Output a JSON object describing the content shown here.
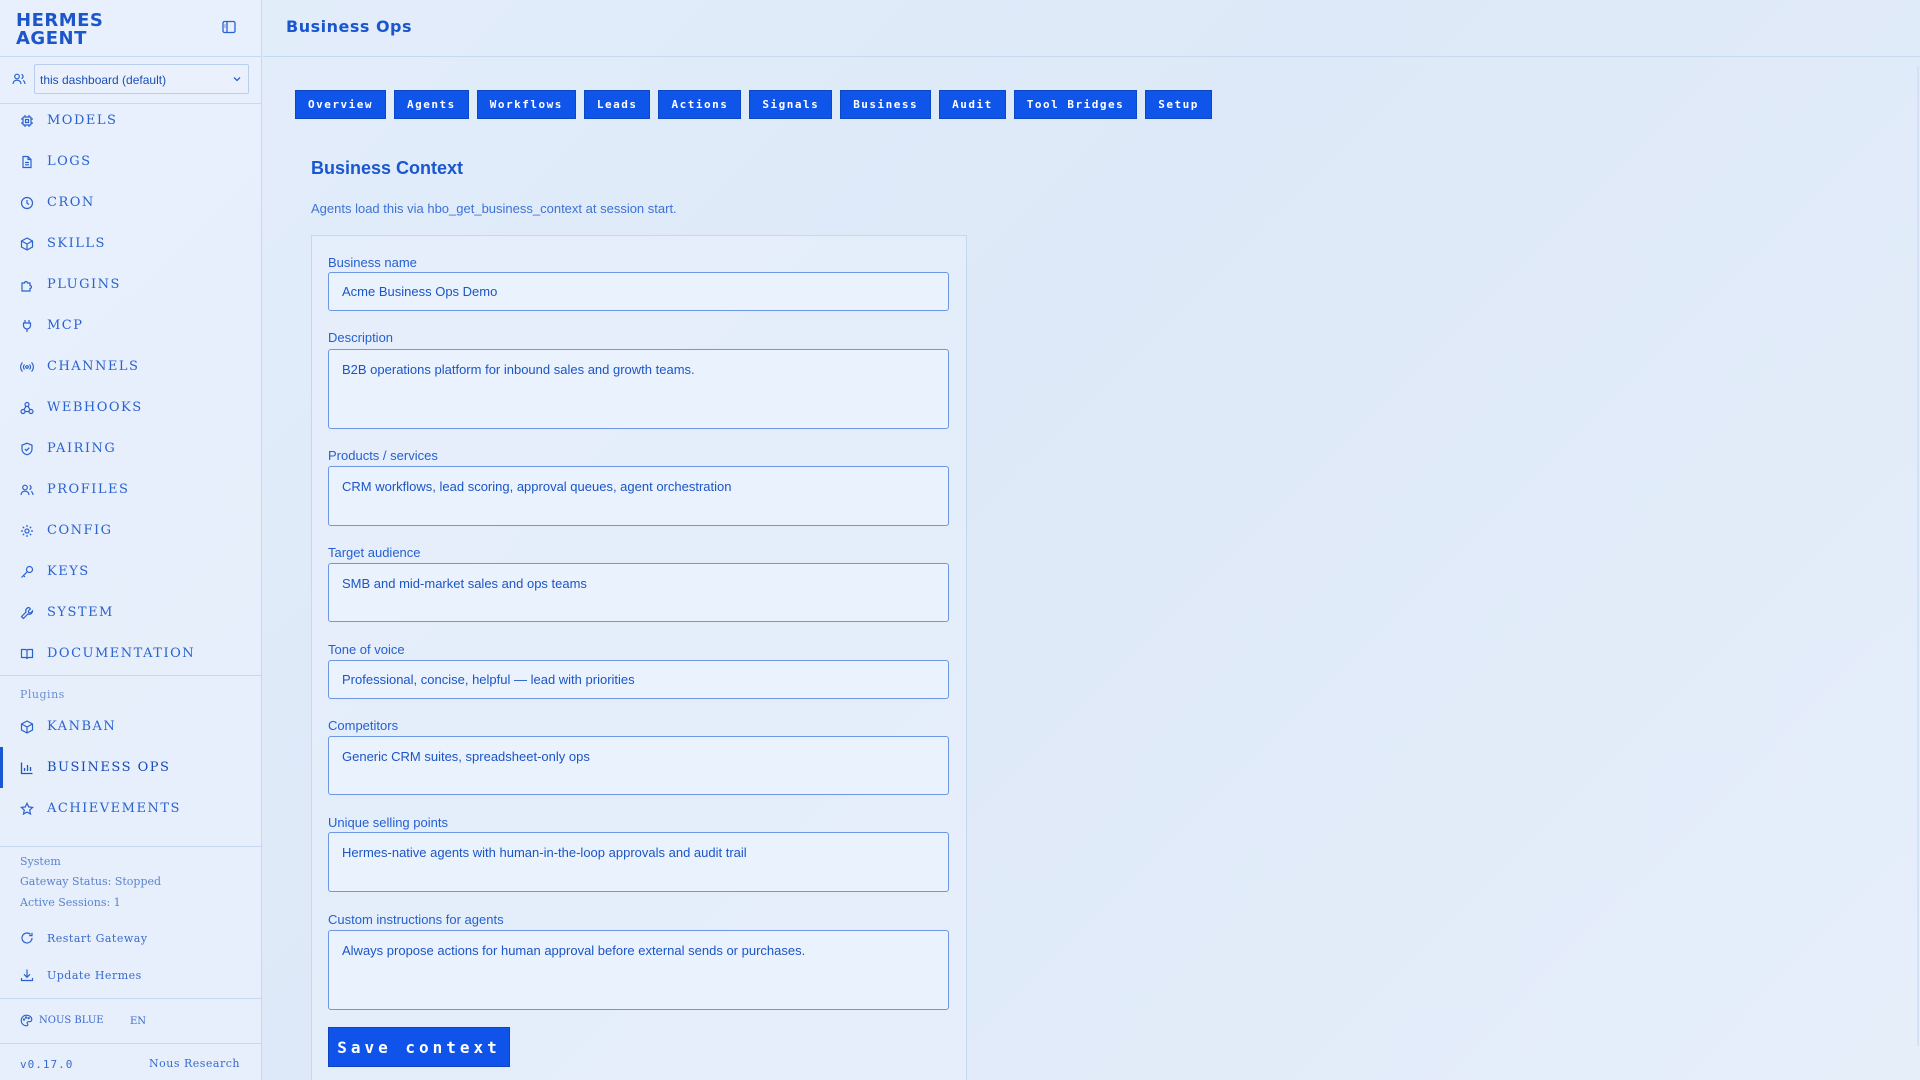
{
  "brand": {
    "line1": "HERMES",
    "line2": "AGENT"
  },
  "profile_select": {
    "value": "this dashboard (default)"
  },
  "nav": {
    "items": [
      {
        "label": "MODELS",
        "icon": "cube-icon"
      },
      {
        "label": "LOGS",
        "icon": "file-icon"
      },
      {
        "label": "CRON",
        "icon": "clock-icon"
      },
      {
        "label": "SKILLS",
        "icon": "package-icon"
      },
      {
        "label": "PLUGINS",
        "icon": "puzzle-icon"
      },
      {
        "label": "MCP",
        "icon": "plug-icon"
      },
      {
        "label": "CHANNELS",
        "icon": "radio-icon"
      },
      {
        "label": "WEBHOOKS",
        "icon": "webhook-icon"
      },
      {
        "label": "PAIRING",
        "icon": "shield-icon"
      },
      {
        "label": "PROFILES",
        "icon": "users-icon"
      },
      {
        "label": "CONFIG",
        "icon": "gear-icon"
      },
      {
        "label": "KEYS",
        "icon": "key-icon"
      },
      {
        "label": "SYSTEM",
        "icon": "wrench-icon"
      },
      {
        "label": "DOCUMENTATION",
        "icon": "book-icon"
      }
    ],
    "plugins_label": "Plugins",
    "plugins": [
      {
        "label": "KANBAN",
        "icon": "package-icon"
      },
      {
        "label": "BUSINESS OPS",
        "icon": "bar-chart-icon",
        "active": true
      },
      {
        "label": "ACHIEVEMENTS",
        "icon": "star-icon"
      }
    ]
  },
  "system": {
    "label": "System",
    "gateway_status": "Gateway Status: Stopped",
    "active_sessions": "Active Sessions: 1",
    "restart_label": "Restart Gateway",
    "update_label": "Update Hermes"
  },
  "footer": {
    "theme": "NOUS BLUE",
    "lang": "EN",
    "version": "v0.17.0",
    "vendor": "Nous Research"
  },
  "header": {
    "title": "Business Ops"
  },
  "tabs": [
    "Overview",
    "Agents",
    "Workflows",
    "Leads",
    "Actions",
    "Signals",
    "Business",
    "Audit",
    "Tool Bridges",
    "Setup"
  ],
  "section": {
    "title": "Business Context",
    "subtitle": "Agents load this via hbo_get_business_context at session start."
  },
  "form": {
    "fields": [
      {
        "label": "Business name",
        "value": "Acme Business Ops Demo"
      },
      {
        "label": "Description",
        "value": "B2B operations platform for inbound sales and growth teams."
      },
      {
        "label": "Products / services",
        "value": "CRM workflows, lead scoring, approval queues, agent orchestration"
      },
      {
        "label": "Target audience",
        "value": "SMB and mid-market sales and ops teams"
      },
      {
        "label": "Tone of voice",
        "value": "Professional, concise, helpful — lead with priorities"
      },
      {
        "label": "Competitors",
        "value": "Generic CRM suites, spreadsheet-only ops"
      },
      {
        "label": "Unique selling points",
        "value": "Hermes-native agents with human-in-the-loop approvals and audit trail"
      },
      {
        "label": "Custom instructions for agents",
        "value": "Always propose actions for human approval before external sends or purchases."
      }
    ],
    "save_label": "Save context"
  },
  "colors": {
    "accent": "#1055e9",
    "text": "#1a56cf",
    "background": "#e2ecf9"
  }
}
